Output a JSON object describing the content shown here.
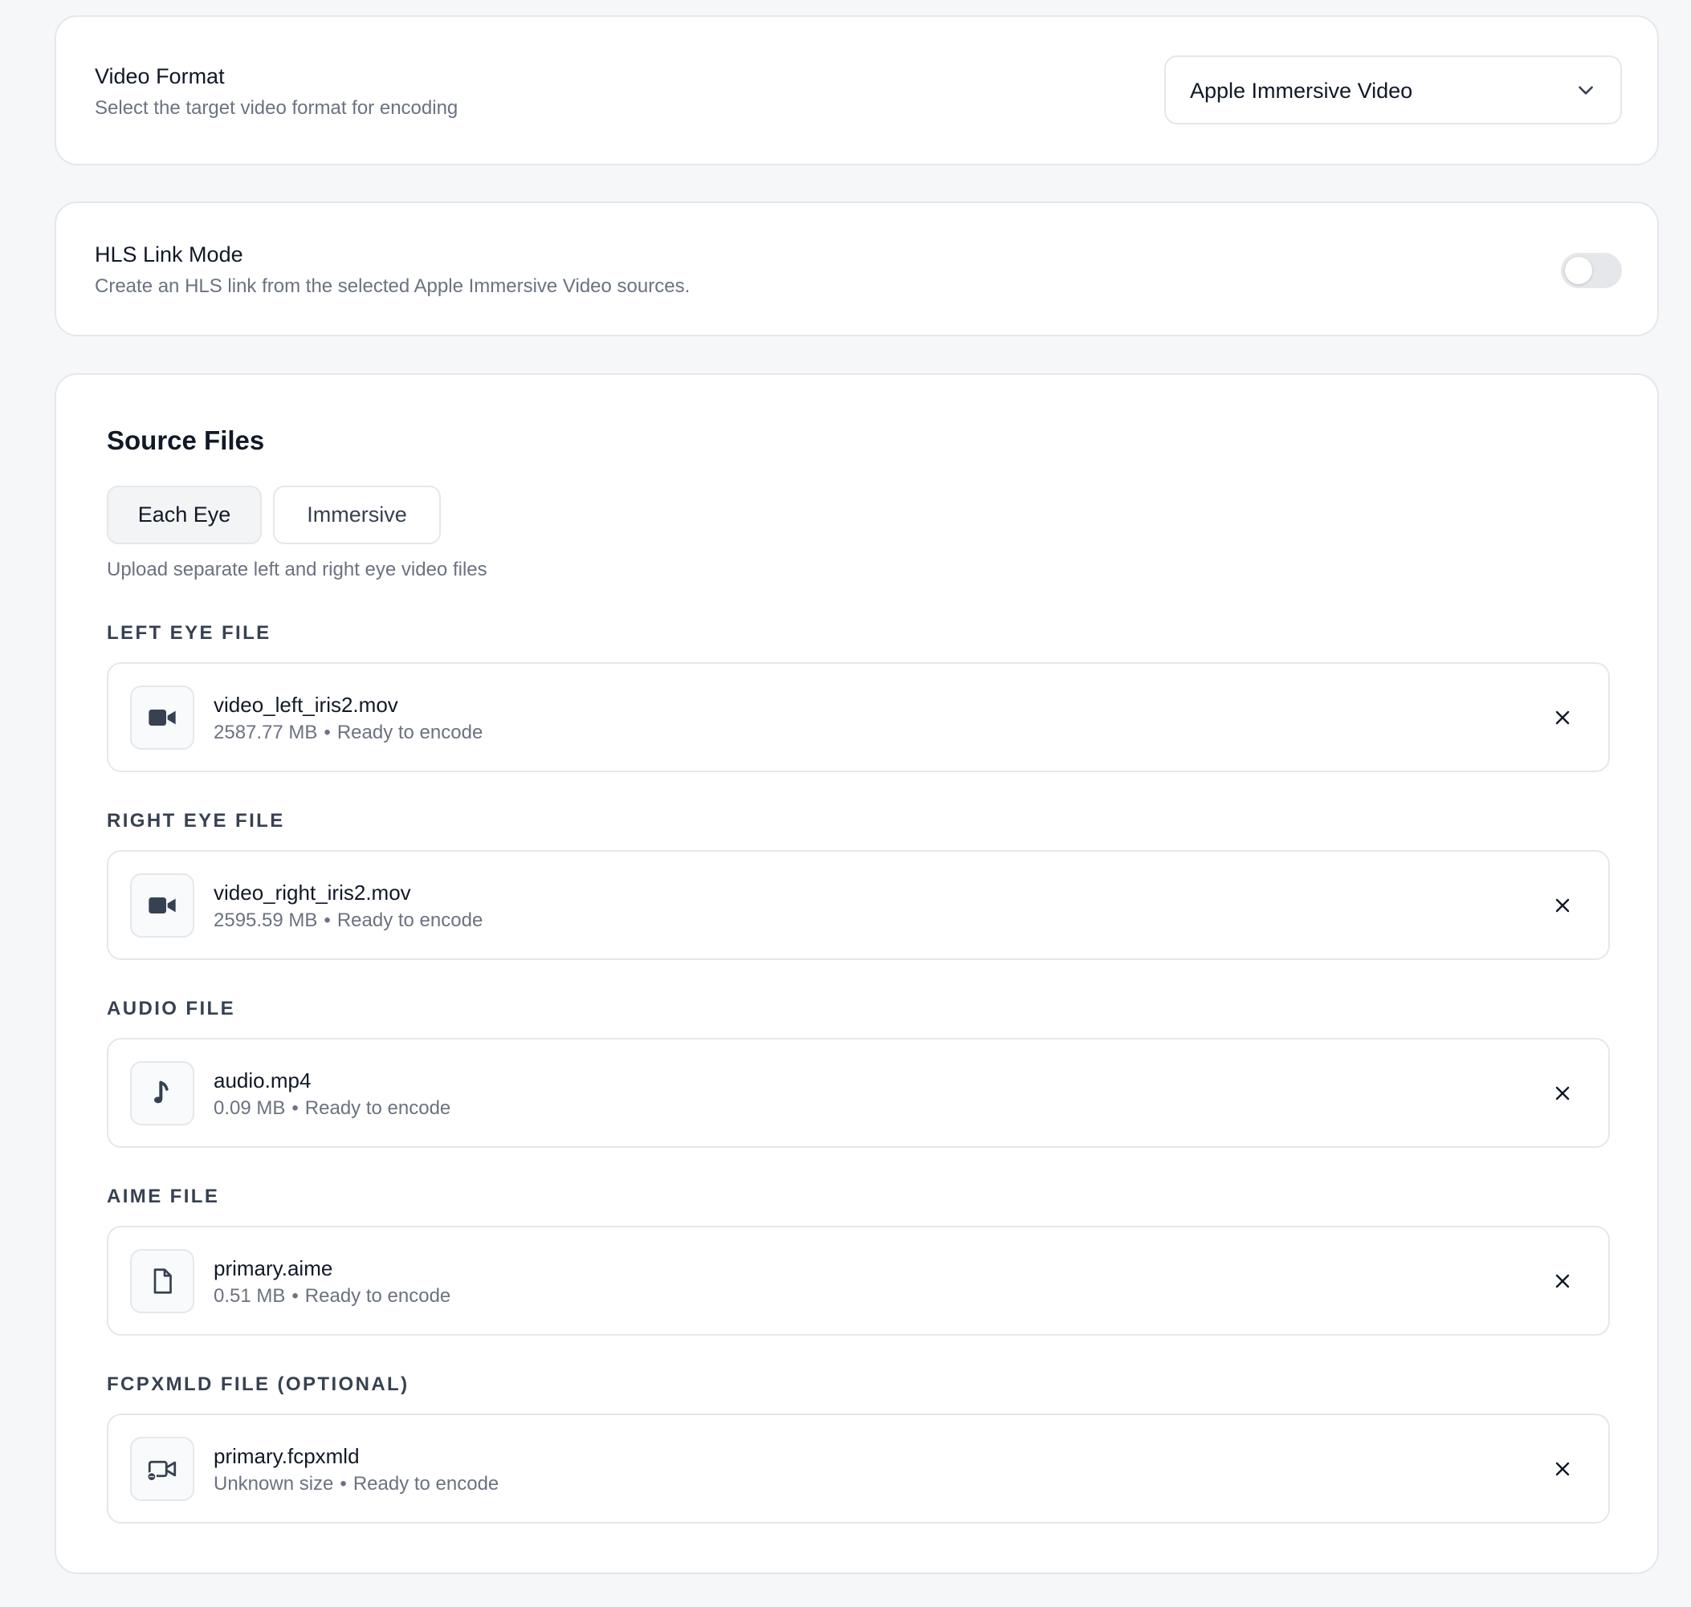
{
  "video_format": {
    "title": "Video Format",
    "subtitle": "Select the target video format for encoding",
    "selected": "Apple Immersive Video"
  },
  "hls": {
    "title": "HLS Link Mode",
    "subtitle": "Create an HLS link from the selected Apple Immersive Video sources.",
    "enabled": false
  },
  "sources": {
    "heading": "Source Files",
    "modes": [
      {
        "label": "Each Eye",
        "active": true
      },
      {
        "label": "Immersive",
        "active": false
      }
    ],
    "hint": "Upload separate left and right eye video files",
    "separator": "•",
    "files": [
      {
        "label": "LEFT EYE FILE",
        "name": "video_left_iris2.mov",
        "size": "2587.77 MB",
        "status": "Ready to encode",
        "icon": "video-camera-icon"
      },
      {
        "label": "RIGHT EYE FILE",
        "name": "video_right_iris2.mov",
        "size": "2595.59 MB",
        "status": "Ready to encode",
        "icon": "video-camera-icon"
      },
      {
        "label": "AUDIO FILE",
        "name": "audio.mp4",
        "size": "0.09 MB",
        "status": "Ready to encode",
        "icon": "music-note-icon"
      },
      {
        "label": "AIME FILE",
        "name": "primary.aime",
        "size": "0.51 MB",
        "status": "Ready to encode",
        "icon": "document-icon"
      },
      {
        "label": "FCPXMLD FILE (OPTIONAL)",
        "name": "primary.fcpxmld",
        "size": "Unknown size",
        "status": "Ready to encode",
        "icon": "video-project-icon"
      }
    ]
  },
  "colors": {
    "background": "#f6f7f8",
    "card": "#ffffff",
    "border": "#e5e7eb",
    "text": "#111827",
    "muted": "#6b7280"
  }
}
